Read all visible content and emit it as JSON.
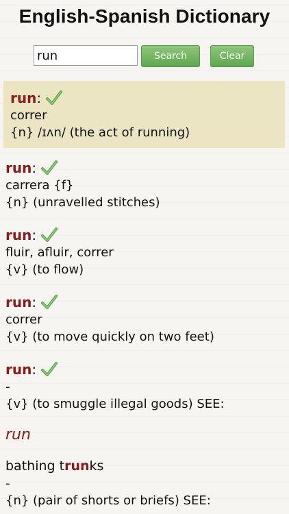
{
  "app": {
    "title": "English-Spanish Dictionary"
  },
  "search": {
    "value": "run",
    "search_label": "Search",
    "clear_label": "Clear"
  },
  "results": [
    {
      "word": "run",
      "translation": "correr",
      "definition": "{n} /ɪʌn/ (the act of running)",
      "verified": true
    },
    {
      "word": "run",
      "translation": "carrera {f}",
      "definition": "{n} (unravelled stitches)",
      "verified": true
    },
    {
      "word": "run",
      "translation": "fluir, afluir, correr",
      "definition": "{v} (to flow)",
      "verified": true
    },
    {
      "word": "run",
      "translation": "correr",
      "definition": "{v} (to move quickly on two feet)",
      "verified": true
    },
    {
      "word": "run",
      "translation": "-",
      "definition": "{v} (to smuggle illegal goods) SEE:",
      "verified": true
    }
  ],
  "related": {
    "word": "run",
    "compound": {
      "prefix": "bathing t",
      "match": "run",
      "suffix": "ks"
    },
    "translation": "-",
    "definition": "{n} (pair of shorts or briefs) SEE:"
  },
  "colors": {
    "accent": "#8b1a1a",
    "button": "#6aaf58",
    "highlight_bg": "#ece5c3"
  },
  "icons": {
    "verified": "checkmark-icon"
  }
}
